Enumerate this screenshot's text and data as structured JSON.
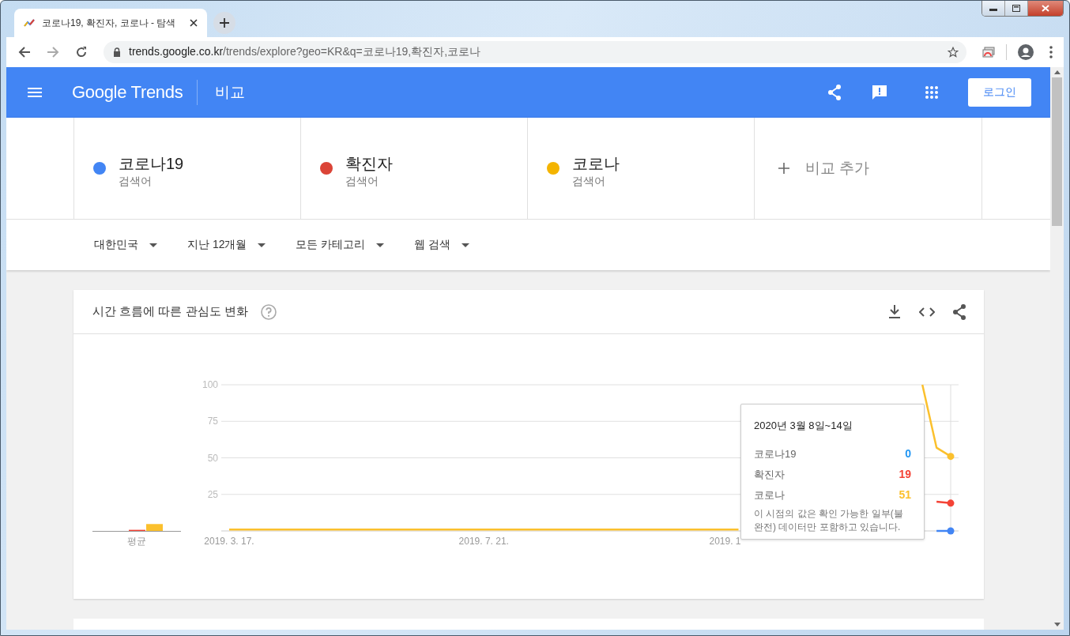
{
  "browser": {
    "tab_title": "코로나19, 확진자, 코로나 - 탐색",
    "url_host": "trends.google.co.kr",
    "url_path": "/trends/explore?geo=KR&q=코로나19,확진자,코로나"
  },
  "header": {
    "brand": "Google Trends",
    "page_title": "비교",
    "login": "로그인"
  },
  "terms": [
    {
      "name": "코로나19",
      "type": "검색어",
      "color": "#4285f4"
    },
    {
      "name": "확진자",
      "type": "검색어",
      "color": "#db4437"
    },
    {
      "name": "코로나",
      "type": "검색어",
      "color": "#f4b400"
    }
  ],
  "add_compare": "비교 추가",
  "filters": [
    "대한민국",
    "지난 12개월",
    "모든 카테고리",
    "웹 검색"
  ],
  "interest": {
    "title": "시간 흐름에 따른 관심도 변화",
    "average_label": "평균",
    "covered_axis_label": "2019. 1",
    "chart_data": {
      "type": "line",
      "categories": [
        "2019. 3. 17.",
        null,
        null,
        null,
        null,
        null,
        null,
        null,
        null,
        null,
        null,
        null,
        null,
        null,
        null,
        null,
        null,
        null,
        "2019. 7. 21.",
        null,
        null,
        null,
        null,
        null,
        null,
        null,
        null,
        null,
        null,
        null,
        null,
        null,
        null,
        null,
        null,
        null,
        null,
        null,
        null,
        null,
        null,
        null,
        null,
        null,
        null,
        null,
        null,
        null,
        null,
        null,
        null,
        null
      ],
      "ylim": [
        0,
        100
      ],
      "yticks": [
        25,
        50,
        75,
        100
      ],
      "grid": true,
      "series": [
        {
          "color": "#4285f4",
          "values": [
            null,
            null,
            null,
            null,
            null,
            null,
            null,
            null,
            null,
            null,
            null,
            null,
            null,
            null,
            null,
            null,
            null,
            null,
            null,
            null,
            null,
            null,
            null,
            null,
            null,
            null,
            null,
            null,
            null,
            null,
            null,
            null,
            null,
            null,
            null,
            null,
            null,
            null,
            null,
            null,
            null,
            null,
            null,
            null,
            null,
            null,
            null,
            null,
            null,
            null,
            0,
            0
          ]
        },
        {
          "color": "#f44336",
          "values": [
            null,
            null,
            null,
            null,
            null,
            null,
            null,
            null,
            null,
            null,
            null,
            null,
            null,
            null,
            null,
            null,
            null,
            null,
            null,
            null,
            null,
            null,
            null,
            null,
            null,
            null,
            null,
            null,
            null,
            null,
            null,
            null,
            null,
            null,
            null,
            null,
            null,
            null,
            null,
            null,
            null,
            null,
            null,
            null,
            null,
            null,
            null,
            null,
            null,
            null,
            20,
            19
          ]
        },
        {
          "color": "#fbc02d",
          "values": [
            1,
            1,
            1,
            1,
            1,
            1,
            1,
            1,
            1,
            1,
            1,
            1,
            1,
            1,
            1,
            1,
            1,
            1,
            1,
            1,
            1,
            1,
            1,
            1,
            1,
            1,
            1,
            1,
            1,
            1,
            1,
            1,
            1,
            1,
            1,
            1,
            1,
            null,
            null,
            null,
            null,
            null,
            null,
            null,
            null,
            null,
            null,
            null,
            null,
            100,
            57,
            51
          ]
        }
      ]
    },
    "tooltip": {
      "date": "2020년 3월 8일~14일",
      "rows": [
        {
          "term": "코로나19",
          "value": "0",
          "color": "#2196f3"
        },
        {
          "term": "확진자",
          "value": "19",
          "color": "#f44336"
        },
        {
          "term": "코로나",
          "value": "51",
          "color": "#fbc02d"
        }
      ],
      "note": "이 시점의 값은 확인 가능한 일부(불완전) 데이터만 포함하고 있습니다."
    }
  }
}
